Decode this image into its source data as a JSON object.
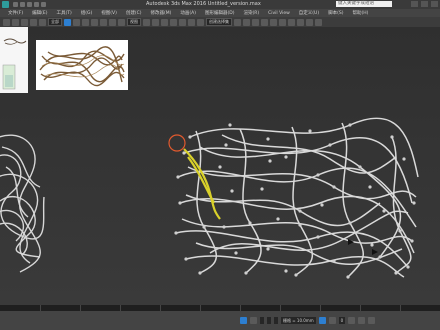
{
  "window": {
    "title": "Autodesk 3ds Max 2016    Untitled_version.max",
    "search_placeholder": "键入关键字或短语"
  },
  "menu": {
    "items": [
      "文件(F)",
      "编辑(E)",
      "工具(T)",
      "组(G)",
      "视图(V)",
      "创建(C)",
      "修改器(M)",
      "动画(A)",
      "图形编辑器(D)",
      "渲染(R)",
      "Civil View",
      "自定义(U)",
      "脚本(S)",
      "帮助(H)"
    ]
  },
  "toolbar": {
    "ref_coord": "视图",
    "selection_set": "创建选择集"
  },
  "statusbar": {
    "grid": "栅格 = 10.0mm",
    "frame": "0"
  },
  "colors": {
    "wire": "#d7d7d7",
    "highlight": "#d9d12a",
    "cursor": "#e25a2e",
    "accent": "#2d7fd1"
  }
}
